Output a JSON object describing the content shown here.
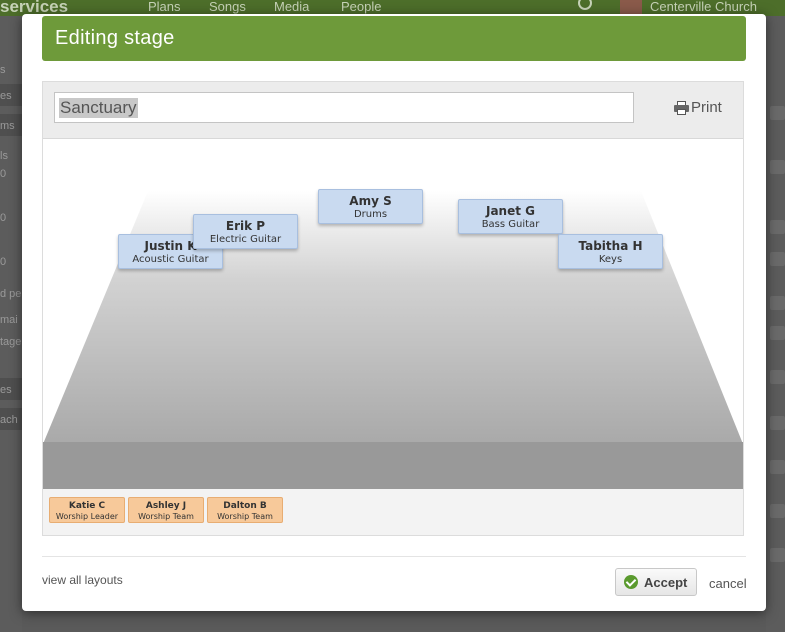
{
  "background_app": {
    "logo": "services",
    "nav": [
      "Plans",
      "Songs",
      "Media",
      "People"
    ],
    "church": "Centerville Church",
    "left_fragments": [
      "s",
      "es",
      "ms",
      "ls",
      "0",
      "0",
      "0",
      "d pe",
      "mai",
      "tage",
      "es",
      "ach"
    ]
  },
  "modal": {
    "title": "Editing stage",
    "stage_name_value": "Sanctuary",
    "print_label": "Print",
    "view_all_label": "view all layouts",
    "accept_label": "Accept",
    "cancel_label": "cancel"
  },
  "stage_positions": [
    {
      "name": "Amy S",
      "role": "Drums"
    },
    {
      "name": "Janet G",
      "role": "Bass Guitar"
    },
    {
      "name": "Justin K",
      "role": "Acoustic Guitar"
    },
    {
      "name": "Erik P",
      "role": "Electric Guitar"
    },
    {
      "name": "Tabitha H",
      "role": "Keys"
    }
  ],
  "unassigned": [
    {
      "name": "Katie C",
      "role": "Worship Leader"
    },
    {
      "name": "Ashley J",
      "role": "Worship Team"
    },
    {
      "name": "Dalton B",
      "role": "Worship Team"
    }
  ],
  "colors": {
    "header_green": "#6e9a3a",
    "stage_card": "#c9daf0",
    "tray_card": "#f7c99a",
    "accept_check": "#5a9a2e"
  }
}
